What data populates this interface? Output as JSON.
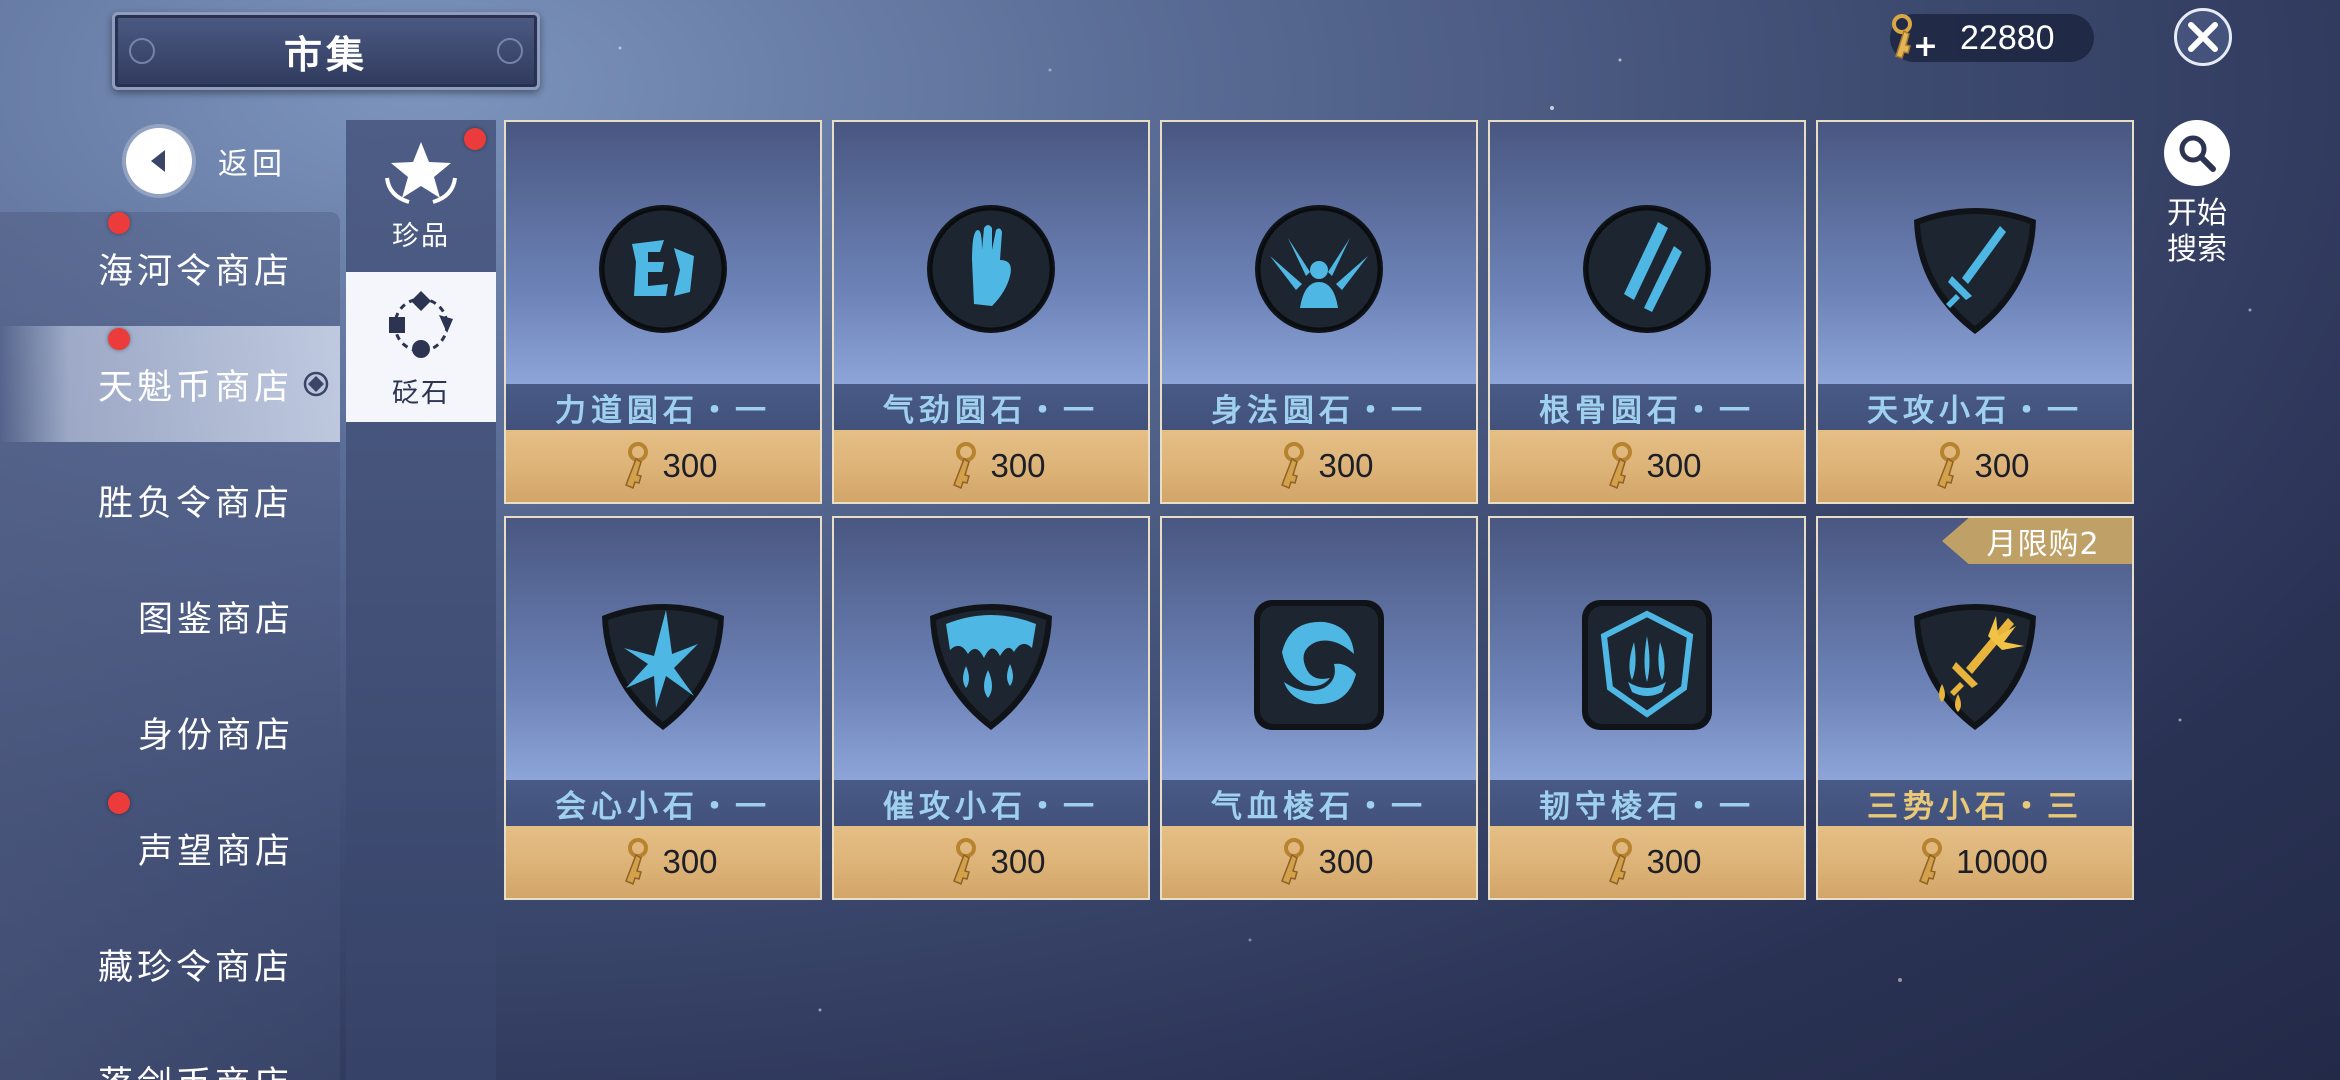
{
  "header": {
    "title": "市集"
  },
  "currency": {
    "amount": "22880",
    "plus": "+"
  },
  "back": {
    "label": "返回"
  },
  "shops": [
    {
      "label": "海河令商店",
      "badge": true
    },
    {
      "label": "天魁币商店",
      "badge": true,
      "active": true
    },
    {
      "label": "胜负令商店",
      "badge": false
    },
    {
      "label": "图鉴商店",
      "badge": false
    },
    {
      "label": "身份商店",
      "badge": false
    },
    {
      "label": "声望商店",
      "badge": true
    },
    {
      "label": "藏珍令商店",
      "badge": false
    },
    {
      "label": "落剑币商店",
      "badge": false
    }
  ],
  "categories": [
    {
      "label": "珍品",
      "badge": true,
      "icon": "star-laurel-icon"
    },
    {
      "label": "砭石",
      "badge": false,
      "active": true,
      "icon": "stone-ring-icon"
    }
  ],
  "items": [
    {
      "name": "力道圆石・一",
      "price": "300",
      "icon": "strength-round-stone-icon"
    },
    {
      "name": "气劲圆石・一",
      "price": "300",
      "icon": "qi-palm-round-stone-icon"
    },
    {
      "name": "身法圆石・一",
      "price": "300",
      "icon": "agility-round-stone-icon"
    },
    {
      "name": "根骨圆石・一",
      "price": "300",
      "icon": "bone-round-stone-icon"
    },
    {
      "name": "天攻小石・一",
      "price": "300",
      "icon": "sword-shield-stone-icon"
    },
    {
      "name": "会心小石・一",
      "price": "300",
      "icon": "critical-shield-stone-icon"
    },
    {
      "name": "催攻小石・一",
      "price": "300",
      "icon": "drip-shield-stone-icon"
    },
    {
      "name": "气血棱石・一",
      "price": "300",
      "icon": "swirl-square-stone-icon"
    },
    {
      "name": "韧守棱石・一",
      "price": "300",
      "icon": "claw-square-stone-icon"
    },
    {
      "name": "三势小石・三",
      "price": "10000",
      "icon": "golden-sword-shield-stone-icon",
      "limit": "月限购2",
      "rare": true
    }
  ],
  "search": {
    "label": "开始\n搜索",
    "line1": "开始",
    "line2": "搜索"
  },
  "colors": {
    "name_blue": "#9fd0ee",
    "name_gold": "#e9c878",
    "price_bg": "#dcb176",
    "badge_red": "#ec3b3b"
  }
}
